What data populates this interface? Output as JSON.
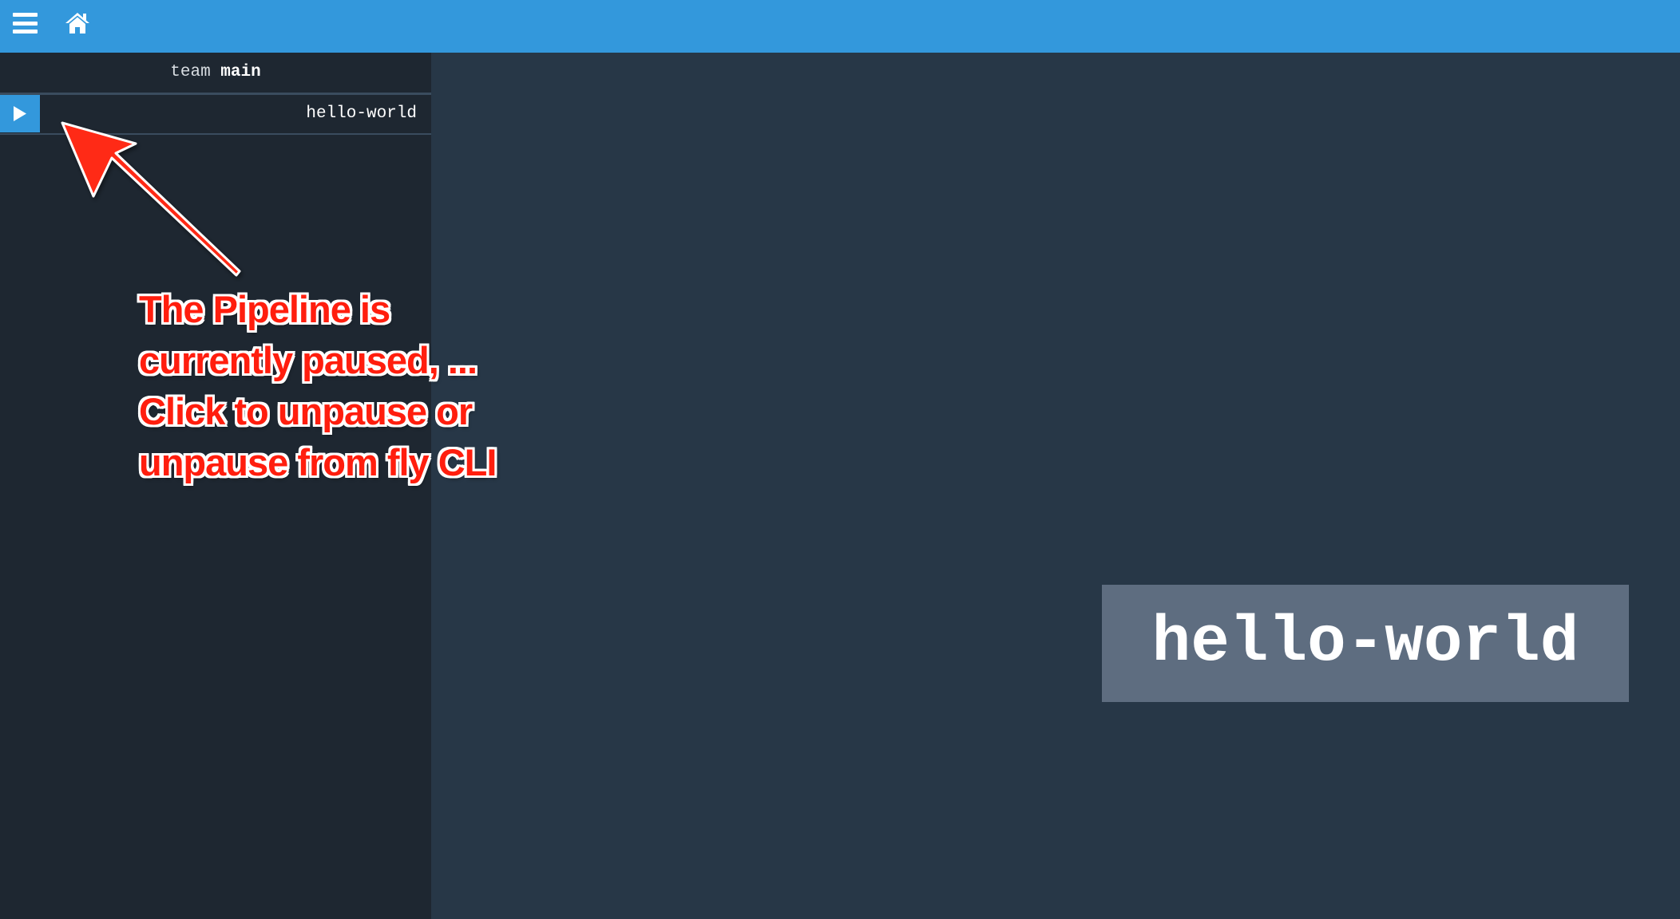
{
  "topbar": {
    "menu_icon": "hamburger-menu-icon",
    "home_icon": "home-icon",
    "color": "#3398dc"
  },
  "sidebar": {
    "team_prefix": "team",
    "team_name": "main",
    "pipelines": [
      {
        "name": "hello-world",
        "paused": true,
        "toggle_icon": "play-icon"
      }
    ]
  },
  "annotation": {
    "lines": [
      "The Pipeline is",
      "currently paused, ...",
      "Click to unpause or",
      "unpause from fly CLI"
    ],
    "color": "#ff1e0e"
  },
  "main": {
    "pipeline_title": "hello-world"
  }
}
